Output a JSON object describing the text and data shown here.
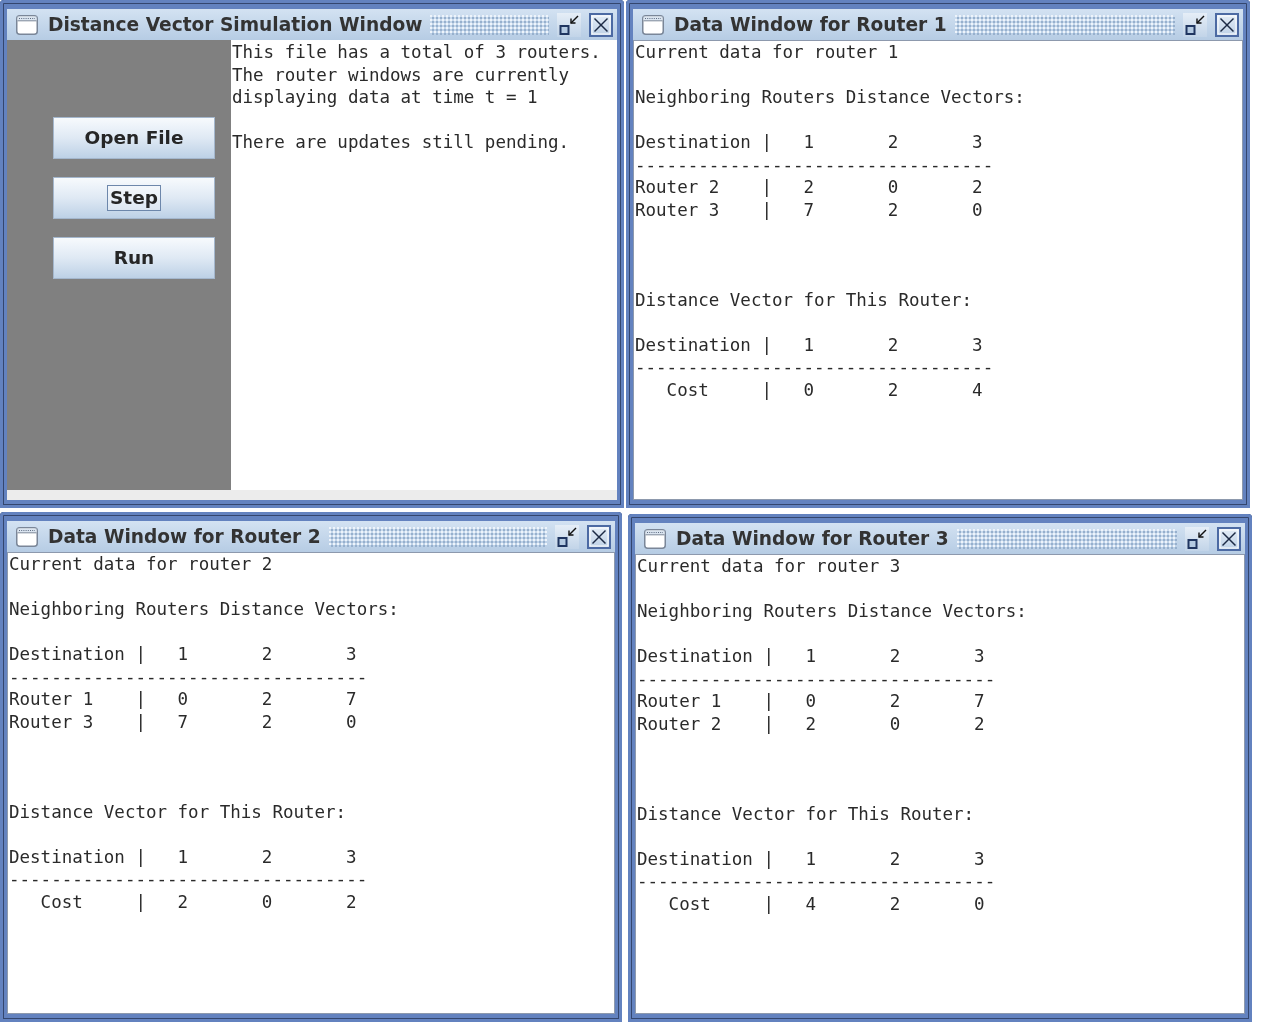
{
  "windows": [
    {
      "kind": "simulation",
      "title": "Distance Vector Simulation Window",
      "buttons": [
        {
          "label": "Open File",
          "focused": false
        },
        {
          "label": "Step",
          "focused": true
        },
        {
          "label": "Run",
          "focused": false
        }
      ],
      "messages": [
        "This file has a total of 3 routers. The router windows are currently displaying data at time t = 1",
        "There are updates still pending."
      ]
    },
    {
      "kind": "router",
      "title": "Data Window for Router 1",
      "heading": "Current data for router 1",
      "tables": [
        {
          "kind": "neighbors",
          "caption": "Neighboring Routers Distance Vectors:",
          "header": {
            "label": "Destination",
            "bar": "|",
            "values": [
              "1",
              "2",
              "3"
            ]
          },
          "rule": "----------------------------------",
          "rows": [
            {
              "label": "Router 2",
              "bar": "|",
              "values": [
                "2",
                "0",
                "2"
              ]
            },
            {
              "label": "Router 3",
              "bar": "|",
              "values": [
                "7",
                "2",
                "0"
              ]
            }
          ]
        },
        {
          "kind": "own",
          "caption": "Distance Vector for This Router:",
          "header": {
            "label": "Destination",
            "bar": "|",
            "values": [
              "1",
              "2",
              "3"
            ]
          },
          "rule": "----------------------------------",
          "rows": [
            {
              "label": "Cost",
              "bar": "|",
              "values": [
                "0",
                "2",
                "4"
              ]
            }
          ]
        }
      ]
    },
    {
      "kind": "router",
      "title": "Data Window for Router 2",
      "heading": "Current data for router 2",
      "tables": [
        {
          "kind": "neighbors",
          "caption": "Neighboring Routers Distance Vectors:",
          "header": {
            "label": "Destination",
            "bar": "|",
            "values": [
              "1",
              "2",
              "3"
            ]
          },
          "rule": "----------------------------------",
          "rows": [
            {
              "label": "Router 1",
              "bar": "|",
              "values": [
                "0",
                "2",
                "7"
              ]
            },
            {
              "label": "Router 3",
              "bar": "|",
              "values": [
                "7",
                "2",
                "0"
              ]
            }
          ]
        },
        {
          "kind": "own",
          "caption": "Distance Vector for This Router:",
          "header": {
            "label": "Destination",
            "bar": "|",
            "values": [
              "1",
              "2",
              "3"
            ]
          },
          "rule": "----------------------------------",
          "rows": [
            {
              "label": "Cost",
              "bar": "|",
              "values": [
                "2",
                "0",
                "2"
              ]
            }
          ]
        }
      ]
    },
    {
      "kind": "router",
      "title": "Data Window for Router 3",
      "heading": "Current data for router 3",
      "tables": [
        {
          "kind": "neighbors",
          "caption": "Neighboring Routers Distance Vectors:",
          "header": {
            "label": "Destination",
            "bar": "|",
            "values": [
              "1",
              "2",
              "3"
            ]
          },
          "rule": "----------------------------------",
          "rows": [
            {
              "label": "Router 1",
              "bar": "|",
              "values": [
                "0",
                "2",
                "7"
              ]
            },
            {
              "label": "Router 2",
              "bar": "|",
              "values": [
                "2",
                "0",
                "2"
              ]
            }
          ]
        },
        {
          "kind": "own",
          "caption": "Distance Vector for This Router:",
          "header": {
            "label": "Destination",
            "bar": "|",
            "values": [
              "1",
              "2",
              "3"
            ]
          },
          "rule": "----------------------------------",
          "rows": [
            {
              "label": "Cost",
              "bar": "|",
              "values": [
                "4",
                "2",
                "0"
              ]
            }
          ]
        }
      ]
    }
  ]
}
